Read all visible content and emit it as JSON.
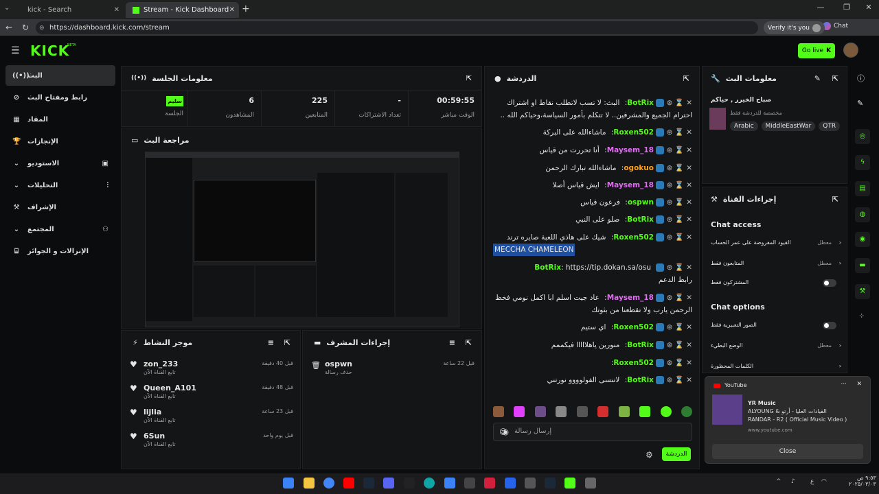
{
  "browser": {
    "tabs": [
      {
        "label": "kick - Search"
      },
      {
        "label": "Stream - Kick Dashboard"
      }
    ],
    "url": "https://dashboard.kick.com/stream",
    "verify": "Verify it's you",
    "chat_btn": "Chat"
  },
  "kick": {
    "logo": "KICK",
    "beta": "BETA",
    "go_live": "Go live"
  },
  "sidebar": {
    "items": [
      {
        "label": "البث"
      },
      {
        "label": "رابط ومفتاح البث"
      },
      {
        "label": "المقاد"
      },
      {
        "label": "الإنجازات"
      },
      {
        "label": "الاستوديو"
      },
      {
        "label": "التحليلات"
      },
      {
        "label": "الإشراف"
      },
      {
        "label": "المجتمع"
      },
      {
        "label": "الإنزالات و الجوائز"
      }
    ]
  },
  "session": {
    "title": "معلومات الجلسة",
    "stats": [
      {
        "value": "00:59:55",
        "label": "الوقت مباشر"
      },
      {
        "value": "-",
        "label": "تعداد الاشتراكات"
      },
      {
        "value": "225",
        "label": "المتابعين"
      },
      {
        "value": "6",
        "label": "المشاهدون"
      },
      {
        "value": "سليم",
        "label": "الجلسة"
      }
    ]
  },
  "preview": {
    "title": "مراجعة البث"
  },
  "activity": {
    "title": "موجز النشاط",
    "items": [
      {
        "user": "zon_233",
        "sub": "تابع القناة الآن",
        "time": "قبل 40 دقيقة"
      },
      {
        "user": "Queen_A101",
        "sub": "تابع القناة الآن",
        "time": "قبل 48 دقيقة"
      },
      {
        "user": "lijlia",
        "sub": "تابع القناة الآن",
        "time": "قبل 23 ساعة"
      },
      {
        "user": "6Sun",
        "sub": "تابع القناة الآن",
        "time": "قبل يوم واحد"
      }
    ]
  },
  "modactions": {
    "title": "إجراءات المشرف",
    "items": [
      {
        "user": "ospwn",
        "sub": "حذف رسالة",
        "time": "قبل 22 ساعة"
      }
    ]
  },
  "chat": {
    "title": "الدردشة",
    "messages": [
      {
        "user": "BotRix",
        "text": "البث: لا تسب لاتطلب نقاط او اشتراك",
        "color": "#53fc18",
        "extra": "احترام الجميع والمشرفين.. لا تتكلم بأمور السياسة،وحياكم الله ..",
        "hl": ""
      },
      {
        "user": "Roxen502",
        "text": "ماشاءالله على البركة",
        "color": "#53fc18",
        "extra": "",
        "hl": ""
      },
      {
        "user": "Maysem_18",
        "text": "أنا تحررت من قياس",
        "color": "#e36bf5",
        "extra": "",
        "hl": ""
      },
      {
        "user": "ogokuo",
        "text": "ماشاءالله تبارك الرحمن",
        "color": "#ff9f1a",
        "extra": "",
        "hl": ""
      },
      {
        "user": "Maysem_18",
        "text": "ايش قياس أصلا",
        "color": "#e36bf5",
        "extra": "",
        "hl": ""
      },
      {
        "user": "ospwn",
        "text": "فرعون قياس",
        "color": "#53fc18",
        "extra": "",
        "hl": ""
      },
      {
        "user": "BotRix",
        "text": "صلو على النبي",
        "color": "#53fc18",
        "extra": "",
        "hl": ""
      },
      {
        "user": "Roxen502",
        "text": "شيك على هاذي اللعبة صايره ترند",
        "color": "#53fc18",
        "extra": "",
        "hl": "MECCHA CHAMELEON"
      },
      {
        "user": "BotRix",
        "text": "https://tip.dokan.sa/osu",
        "color": "#53fc18",
        "extra": "رابط الدعم",
        "hl": ""
      },
      {
        "user": "Maysem_18",
        "text": "عاد جيت اسلم ابا اكمل نومي فخظ",
        "color": "#e36bf5",
        "extra": "الرحمن يارب ولا تقطعنا من بثوتك",
        "hl": ""
      },
      {
        "user": "Roxen502",
        "text": "اي ستيم",
        "color": "#53fc18",
        "extra": "",
        "hl": ""
      },
      {
        "user": "BotRix",
        "text": "منورين ياهلااااا فيكممم",
        "color": "#53fc18",
        "extra": "",
        "hl": ""
      },
      {
        "user": "Roxen502",
        "text": "",
        "color": "#53fc18",
        "extra": "",
        "hl": ""
      },
      {
        "user": "BotRix",
        "text": "لاتنسى الفولوووو نورتني",
        "color": "#53fc18",
        "extra": "",
        "hl": ""
      }
    ],
    "input_placeholder": "إرسال رسالة",
    "send": "الدردشة"
  },
  "streaminfo": {
    "title": "معلومات البث",
    "stream_title": "صباح الخيرر , حياكم",
    "category": "مخصصة للدردشة فقط",
    "tags": [
      "Arabic",
      "MiddleEastWar",
      "QTR"
    ]
  },
  "channel": {
    "title": "إجراءات القناة",
    "access_title": "Chat access",
    "access": [
      {
        "label": "القيود المفروضة على عمر الحساب",
        "value": "معطل"
      },
      {
        "label": "المتابعون فقط",
        "value": "معطل"
      },
      {
        "label": "المشتركون فقط",
        "value": ""
      }
    ],
    "options_title": "Chat options",
    "options": [
      {
        "label": "الصور التعبيرية فقط",
        "value": ""
      },
      {
        "label": "الوضع البطيء",
        "value": "معطل"
      },
      {
        "label": "الكلمات المحظورة",
        "value": ""
      }
    ]
  },
  "toast": {
    "app": "YouTube",
    "title": "YR Music",
    "line1": "ALYOUNG & القيادات العليا - أرتو",
    "line2": "RANDAR - R2 ( Official Music Video )",
    "url": "www.youtube.com",
    "close": "Close"
  },
  "tray": {
    "time": "٩:٥٣ ص",
    "date": "٢٠٢٥/٠٣/٠٣",
    "lang": "ع"
  }
}
